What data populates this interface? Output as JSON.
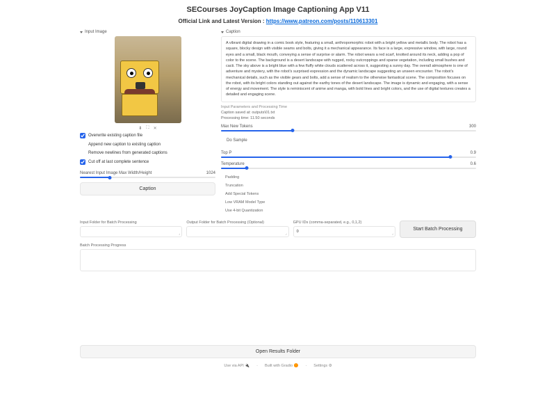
{
  "title": "SECourses JoyCaption Image Captioning App V11",
  "subtitle_prefix": "Official Link and Latest Version : ",
  "subtitle_link": "https://www.patreon.com/posts/110613301",
  "input_image_label": "Input Image",
  "caption_label": "Caption",
  "caption_text": "A vibrant digital drawing in a comic book style, featuring a small, anthropomorphic robot with a bright yellow and metallic body. The robot has a square, blocky design with visible seams and bolts, giving it a mechanical appearance. Its face is a large, expressive window, with large, round eyes and a small, black mouth, conveying a sense of surprise or alarm. The robot wears a red scarf, knotted around its neck, adding a pop of color to the scene. The background is a desert landscape with rugged, rocky outcroppings and sparse vegetation, including small bushes and cacti. The sky above is a bright blue with a few fluffy white clouds scattered across it, suggesting a sunny day. The overall atmosphere is one of adventure and mystery, with the robot's surprised expression and the dynamic landscape suggesting an unseen encounter. The robot's mechanical details, such as the visible gears and bolts, add a sense of realism to the otherwise fantastical scene. The composition focuses on the robot, with its bright colors standing out against the earthy tones of the desert landscape. The image is dynamic and engaging, with a sense of energy and movement. The style is reminiscent of anime and manga, with bold lines and bright colors, and the use of digital textures creates a detailed and engaging scene.",
  "info_header": "Input Parameters and Processing Time",
  "info_line1": "Caption saved at: outputs\\01.txt",
  "info_line2": "Processing time: 11.50 seconds",
  "checkboxes": {
    "overwrite": "Overwrite existing caption file",
    "append": "Append new caption to existing caption",
    "remove": "Remove newlines from generated captions",
    "cutoff": "Cut off at last complete sentence"
  },
  "sliders": {
    "max_new_tokens": {
      "label": "Max New Tokens",
      "value": 300,
      "pct": 12
    },
    "do_sample": {
      "label": "Do Sample",
      "value": "",
      "pct": 0
    },
    "top_p": {
      "label": "Top P",
      "value": 0.9,
      "pct": 90
    },
    "temperature": {
      "label": "Temperature",
      "value": 0.6,
      "pct": 30
    },
    "image_max_width": {
      "label": "Nearest Input Image Max Width/Height",
      "value": 1024,
      "pct": 22
    }
  },
  "caption_btn": "Caption",
  "options": {
    "o1": "Padding",
    "o2": "Truncation",
    "o3": "Add Special Tokens",
    "o4": "Low VRAM Model Type",
    "o5": "Use 4-bit Quantization"
  },
  "fields": {
    "f1": "Input Folder for Batch Processing",
    "f2": "Output Folder for Batch Processing (Optional)",
    "f3": "GPU IDs (comma-separated, e.g., 0,1,2)",
    "f3_value": "0"
  },
  "batch_btn": "Start Batch Processing",
  "progress_label": "Batch Processing Progress",
  "open_results_btn": "Open Results Folder",
  "footer": {
    "api": "Use via API",
    "built": "Built with Gradio",
    "settings": "Settings"
  }
}
